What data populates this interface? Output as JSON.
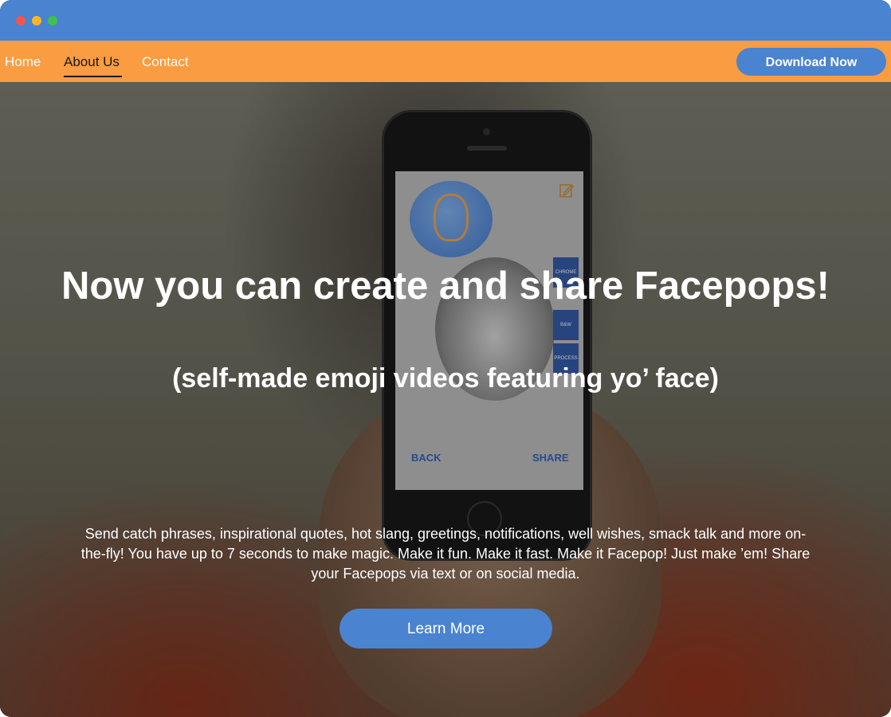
{
  "window": {
    "controls": [
      "close",
      "minimize",
      "maximize"
    ]
  },
  "nav": {
    "links": [
      {
        "label": "Home",
        "active": false
      },
      {
        "label": "About Us",
        "active": true
      },
      {
        "label": "Contact",
        "active": false
      }
    ],
    "download_label": "Download Now"
  },
  "hero": {
    "title": "Now you can create and share Facepops!",
    "subtitle": "(self-made emoji videos featuring yo’ face)",
    "body": "Send catch phrases, inspirational quotes, hot slang, greetings, notifications, well wishes, smack talk and more on-the-fly! You have up to 7 seconds to make magic. Make it fun. Make it fast. Make it Facepop! Just make ’em! Share your Facepops via text or on social media.",
    "cta_label": "Learn More",
    "phone": {
      "tabs": [
        "CHROME",
        "B&W",
        "PROCESS"
      ],
      "back_label": "BACK",
      "share_label": "SHARE"
    }
  },
  "colors": {
    "titlebar": "#4a83cf",
    "navbar": "#fa9c41",
    "button": "#4a83cf",
    "text": "#ffffff"
  }
}
